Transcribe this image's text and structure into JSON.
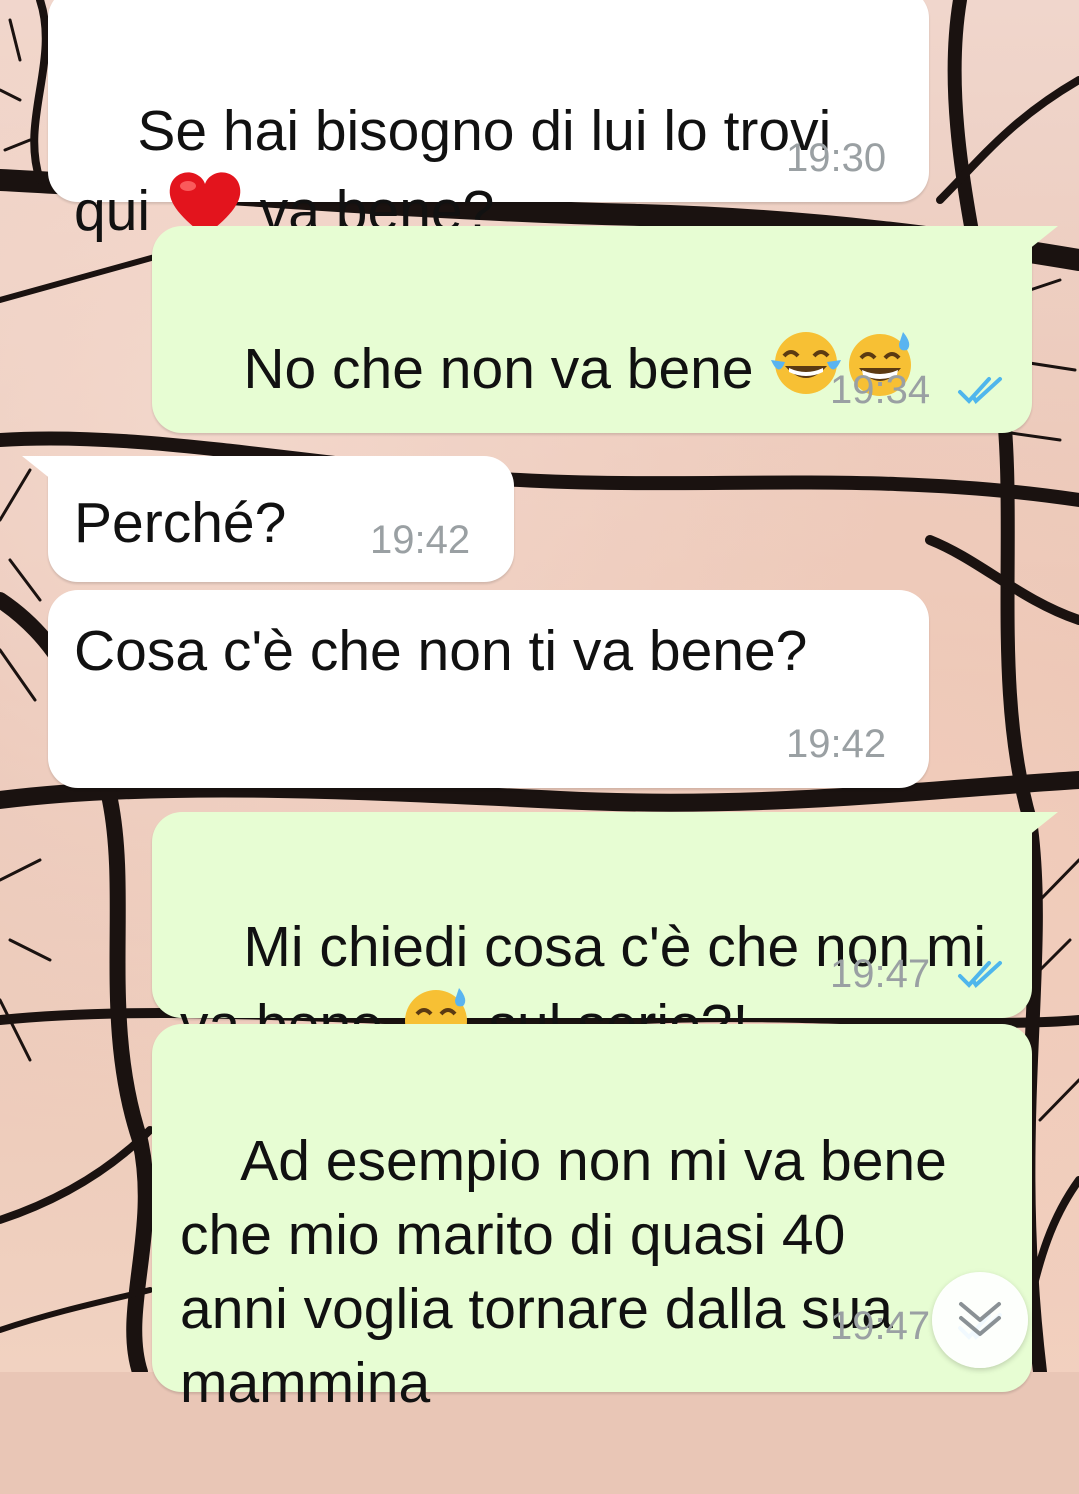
{
  "messages": [
    {
      "direction": "incoming",
      "lines": [
        "Se hai bisogno di lui lo trovi",
        "qui",
        "va bene?"
      ],
      "emojis": [
        "red-heart"
      ],
      "time": "19:30"
    },
    {
      "direction": "outgoing",
      "text": "No che non va bene",
      "emojis": [
        "face-with-tears-of-joy",
        "grinning-face-with-sweat"
      ],
      "time": "19:34",
      "status": "read"
    },
    {
      "direction": "incoming",
      "text": "Perché?",
      "time": "19:42"
    },
    {
      "direction": "incoming",
      "text": "Cosa c'è che non ti va bene?",
      "time": "19:42"
    },
    {
      "direction": "outgoing",
      "lines": [
        "Mi chiedi cosa c'è che non mi",
        "va bene",
        "sul serio?!"
      ],
      "emojis": [
        "grinning-face-with-sweat"
      ],
      "time": "19:47",
      "status": "read"
    },
    {
      "direction": "outgoing",
      "lines": [
        "Ad esempio non mi va bene",
        "che mio marito di quasi 40",
        "anni voglia tornare dalla sua",
        "mammina"
      ],
      "time": "19:47",
      "status": "read"
    }
  ],
  "scroll_button": {
    "icon": "double-chevron-down-icon"
  },
  "colors": {
    "incoming_bubble": "#ffffff",
    "outgoing_bubble": "#e7fdd3",
    "timestamp": "#9aa0a3",
    "read_ticks": "#4fb6ec",
    "text": "#111111"
  }
}
